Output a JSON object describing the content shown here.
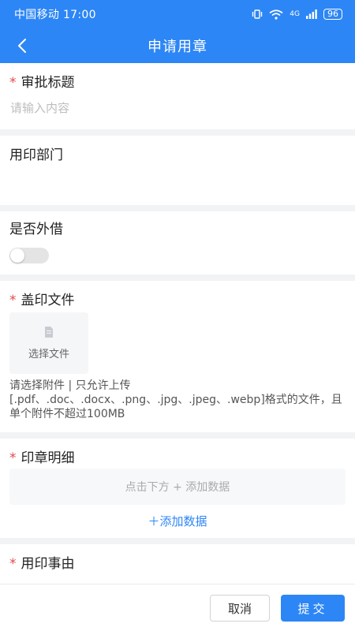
{
  "status_bar": {
    "carrier_time": "中国移动 17:00",
    "network": "4G",
    "battery": "96"
  },
  "header": {
    "title": "申请用章"
  },
  "form": {
    "approval_title": {
      "required_mark": "*",
      "label": "审批标题",
      "placeholder": "请输入内容"
    },
    "department": {
      "label": "用印部门"
    },
    "external_loan": {
      "label": "是否外借",
      "value": false
    },
    "stamp_file": {
      "required_mark": "*",
      "label": "盖印文件",
      "upload_label": "选择文件",
      "tip": "请选择附件 | 只允许上传 [.pdf、.doc、.docx、.png、.jpg、.jpeg、.webp]格式的文件，且单个附件不超过100MB"
    },
    "seal_details": {
      "required_mark": "*",
      "label": "印章明细",
      "empty_text": "点击下方 + 添加数据",
      "add_label": "＋添加数据"
    },
    "reason": {
      "required_mark": "*",
      "label": "用印事由"
    }
  },
  "actions": {
    "cancel_label": "取消",
    "submit_label": "提交"
  },
  "colors": {
    "primary": "#2d86f5",
    "required": "#e5484d"
  }
}
